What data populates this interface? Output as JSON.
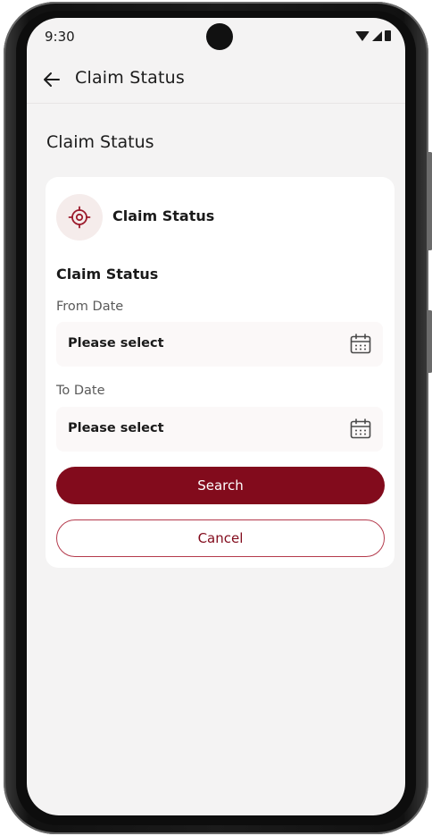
{
  "status_bar": {
    "time": "9:30",
    "icons": [
      "wifi-icon",
      "signal-icon",
      "battery-icon"
    ]
  },
  "app_bar": {
    "title": "Claim Status",
    "back_icon": "arrow-left-icon"
  },
  "page": {
    "heading": "Claim Status"
  },
  "card": {
    "header_icon": "target-icon",
    "header_title": "Claim Status",
    "form_title": "Claim Status",
    "from_date": {
      "label": "From Date",
      "value": "Please select",
      "icon": "calendar-icon"
    },
    "to_date": {
      "label": "To Date",
      "value": "Please select",
      "icon": "calendar-icon"
    },
    "search_label": "Search",
    "cancel_label": "Cancel"
  },
  "colors": {
    "primary": "#820b1c",
    "screen_background": "#f4f3f3",
    "card_background": "#ffffff",
    "field_background": "#fbf8f8"
  }
}
